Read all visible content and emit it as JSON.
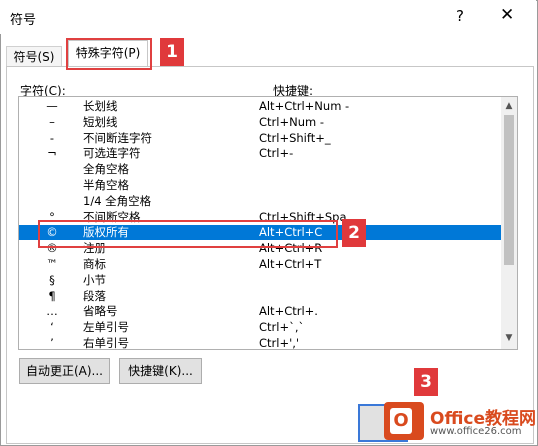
{
  "window": {
    "title": "符号",
    "help": "?",
    "close": "✕"
  },
  "tabs": [
    {
      "label": "符号(S)"
    },
    {
      "label": "特殊字符(P)"
    }
  ],
  "headers": {
    "char": "字符(C):",
    "shortcut": "快捷键:"
  },
  "rows": [
    {
      "sym": "—",
      "name": "长划线",
      "key": "Alt+Ctrl+Num -"
    },
    {
      "sym": "–",
      "name": "短划线",
      "key": "Ctrl+Num -"
    },
    {
      "sym": "-",
      "name": "不间断连字符",
      "key": "Ctrl+Shift+_"
    },
    {
      "sym": "¬",
      "name": "可选连字符",
      "key": "Ctrl+-"
    },
    {
      "sym": "",
      "name": "全角空格",
      "key": ""
    },
    {
      "sym": "",
      "name": "半角空格",
      "key": ""
    },
    {
      "sym": "",
      "name": "1/4 全角空格",
      "key": ""
    },
    {
      "sym": "°",
      "name": "不间断空格",
      "key": "Ctrl+Shift+Spa"
    },
    {
      "sym": "©",
      "name": "版权所有",
      "key": "Alt+Ctrl+C"
    },
    {
      "sym": "®",
      "name": "注册",
      "key": "Alt+Ctrl+R"
    },
    {
      "sym": "™",
      "name": "商标",
      "key": "Alt+Ctrl+T"
    },
    {
      "sym": "§",
      "name": "小节",
      "key": ""
    },
    {
      "sym": "¶",
      "name": "段落",
      "key": ""
    },
    {
      "sym": "…",
      "name": "省略号",
      "key": "Alt+Ctrl+."
    },
    {
      "sym": "‘",
      "name": "左单引号",
      "key": "Ctrl+`,`"
    },
    {
      "sym": "’",
      "name": "右单引号",
      "key": "Ctrl+','"
    }
  ],
  "selected_row": "版权所有",
  "buttons": {
    "autocorrect": "自动更正(A)...",
    "shortcut": "快捷键(K)..."
  },
  "callouts": {
    "n1": "1",
    "n2": "2",
    "n3": "3"
  },
  "logo": {
    "letter": "O",
    "text": "Office教程网",
    "sub": "www.office26.com"
  },
  "colors": {
    "selection": "#0078d7",
    "callout": "#e0393b",
    "logo": "#d94a1e"
  }
}
